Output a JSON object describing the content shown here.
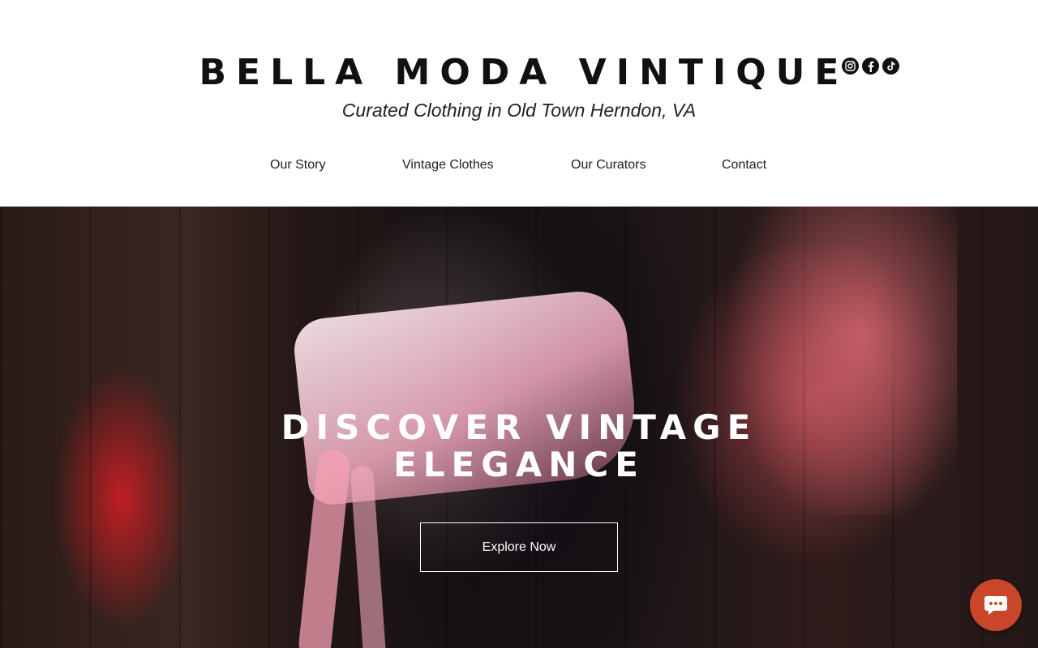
{
  "header": {
    "brand": "BELLA MODA VINTIQUE",
    "tagline": "Curated Clothing in Old Town Herndon, VA"
  },
  "social": [
    {
      "name": "Instagram",
      "icon": "instagram-icon"
    },
    {
      "name": "Facebook",
      "icon": "facebook-icon"
    },
    {
      "name": "TikTok",
      "icon": "tiktok-icon"
    }
  ],
  "nav": {
    "items": [
      {
        "label": "Our Story"
      },
      {
        "label": "Vintage Clothes"
      },
      {
        "label": "Our Curators"
      },
      {
        "label": "Contact"
      }
    ]
  },
  "hero": {
    "title_line1": "DISCOVER VINTAGE",
    "title_line2": "ELEGANCE",
    "cta": "Explore Now"
  },
  "chat": {
    "icon": "chat-icon",
    "color": "#c9462a"
  }
}
